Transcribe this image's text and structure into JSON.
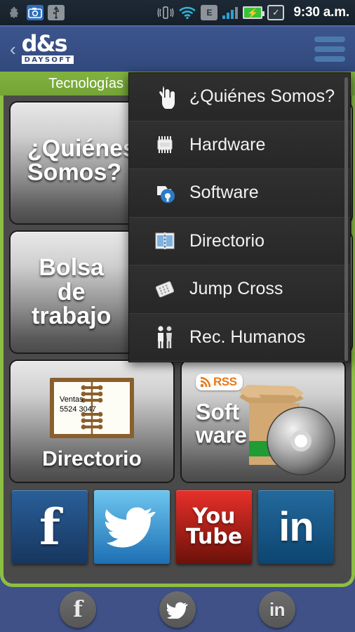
{
  "statusbar": {
    "time": "9:30 a.m.",
    "left_icons": [
      "app-icon",
      "camera-icon",
      "usb-icon"
    ],
    "right_icons": [
      "vibrate-icon",
      "wifi-icon",
      "edge-icon",
      "signal-icon",
      "battery-charging-icon",
      "checkbox-icon"
    ],
    "edge_label": "E",
    "battery_glyph": "⚡"
  },
  "header": {
    "back_glyph": "‹",
    "logo_main": "d&s",
    "logo_sub": "DAYSOFT",
    "menu_icon": "hamburger-icon",
    "bg_color": "#36508a"
  },
  "section": {
    "title": "Tecnologías",
    "bg_color": "#7ab03c"
  },
  "tiles": [
    {
      "id": "quienes-somos",
      "label_line1": "¿Quiénes",
      "label_line2": "Somos?",
      "icon": "pointing-hand-icon"
    },
    {
      "id": "bolsa-de-trabajo",
      "label_line1": "Bolsa",
      "label_line2": "de",
      "label_line3": "trabajo",
      "icon": "businessman-icon"
    },
    {
      "id": "directorio",
      "label": "Directorio",
      "icon": "notebook-icon",
      "note_line1": "Ventas",
      "note_line2": "5524 3047"
    },
    {
      "id": "software",
      "label_line1": "Soft",
      "label_line2": "ware",
      "icon": "box-and-disc-icon",
      "rss_label": "RSS"
    }
  ],
  "social_buttons": [
    {
      "name": "facebook",
      "glyph": "f",
      "color": "#2a5f99"
    },
    {
      "name": "twitter",
      "glyph": "bird",
      "color": "#46a8e0"
    },
    {
      "name": "youtube",
      "line1": "You",
      "line2": "Tube",
      "color": "#e8302a"
    },
    {
      "name": "linkedin",
      "glyph": "in",
      "color": "#24699d"
    }
  ],
  "bottom_bar": [
    {
      "name": "facebook",
      "glyph": "f"
    },
    {
      "name": "twitter",
      "glyph": "bird"
    },
    {
      "name": "linkedin",
      "glyph": "in"
    }
  ],
  "menu": {
    "items": [
      {
        "label": "¿Quiénes Somos?",
        "icon": "pointing-hand-icon"
      },
      {
        "label": "Hardware",
        "icon": "chip-icon"
      },
      {
        "label": "Software",
        "icon": "software-disc-icon"
      },
      {
        "label": "Directorio",
        "icon": "directory-book-icon"
      },
      {
        "label": "Jump Cross",
        "icon": "jump-cross-icon"
      },
      {
        "label": "Rec. Humanos",
        "icon": "people-icon"
      }
    ]
  }
}
